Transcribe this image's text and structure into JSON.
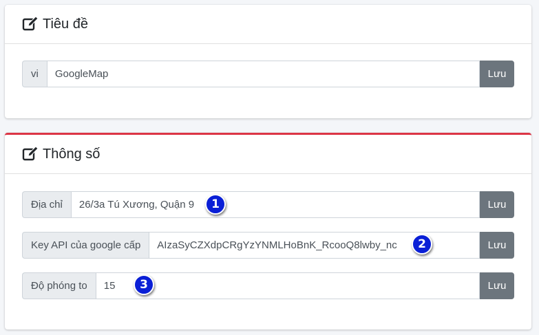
{
  "title_card": {
    "title": "Tiêu đề",
    "row": {
      "prefix": "vi",
      "value": "GoogleMap",
      "save_label": "Lưu"
    }
  },
  "params_card": {
    "title": "Thông số",
    "accent_color": "#dc3545",
    "rows": [
      {
        "label": "Địa chỉ",
        "value": "26/3a Tú Xương, Quận 9",
        "save_label": "Lưu",
        "badge": "1"
      },
      {
        "label": "Key API của google cấp",
        "value": "AIzaSyCZXdpCRgYzYNMLHoBnK_RcooQ8lwby_nc",
        "save_label": "Lưu",
        "badge": "2"
      },
      {
        "label": "Độ phóng to",
        "value": "15",
        "save_label": "Lưu",
        "badge": "3"
      }
    ]
  },
  "icons": {
    "header_icon": "edit-icon"
  },
  "colors": {
    "button": "#6c757d",
    "badge": "#0a1fd6"
  }
}
